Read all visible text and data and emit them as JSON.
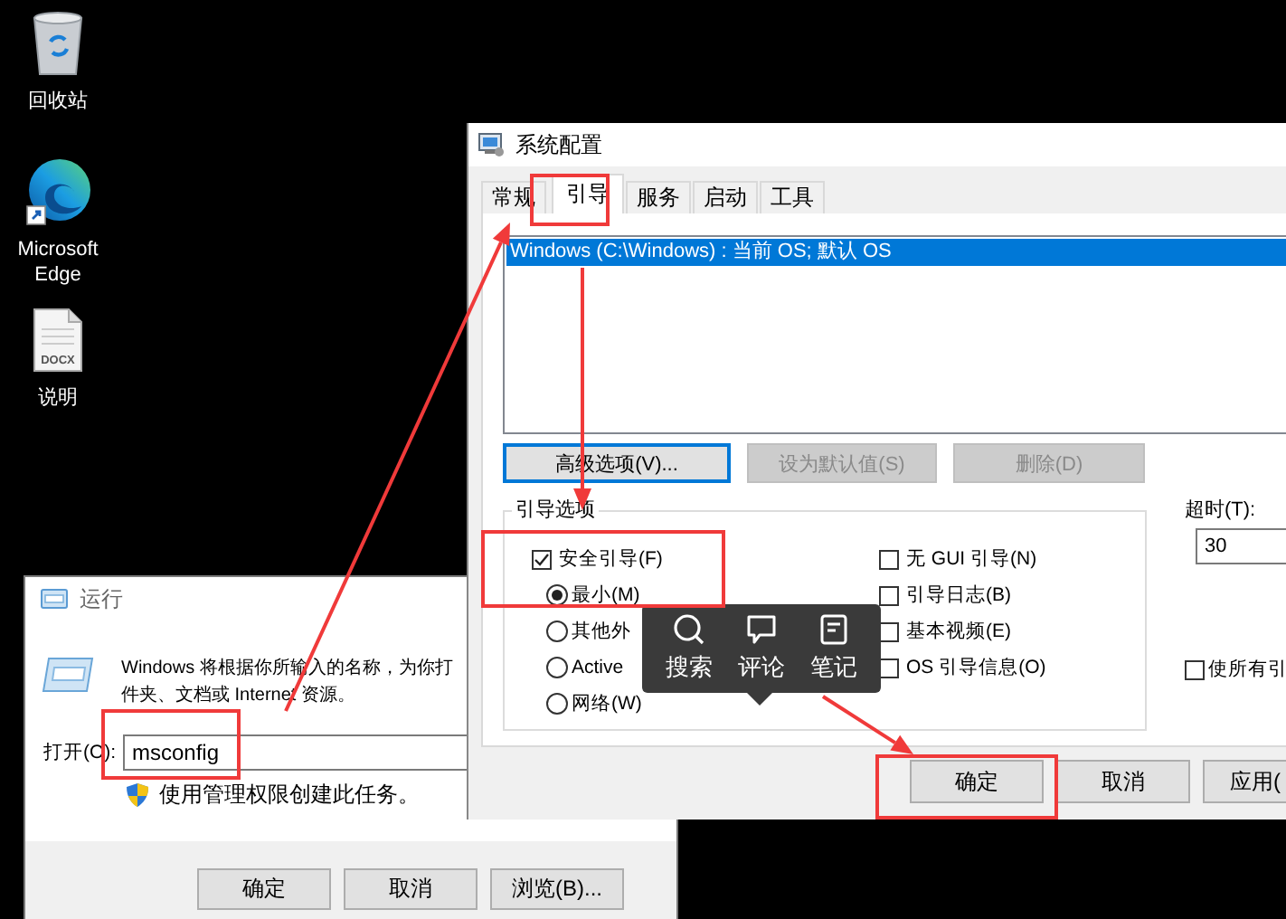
{
  "desktop": {
    "icons": [
      {
        "kind": "recycle-bin",
        "label": "回收站"
      },
      {
        "kind": "edge",
        "label": "Microsoft Edge"
      },
      {
        "kind": "document",
        "label": "说明",
        "file_type": "DOCX"
      }
    ]
  },
  "run_dialog": {
    "title": "运行",
    "description_lines": [
      "Windows 将根据你所输入的名称，为你打",
      "件夹、文档或 Internet 资源。"
    ],
    "open_label": "打开(O):",
    "open_value": "msconfig",
    "admin_note": "使用管理权限创建此任务。",
    "buttons": [
      "确定",
      "取消",
      "浏览(B)..."
    ]
  },
  "system_config": {
    "title": "系统配置",
    "tabs": [
      {
        "label": "常规",
        "selected": false
      },
      {
        "label": "引导",
        "selected": true
      },
      {
        "label": "服务",
        "selected": false
      },
      {
        "label": "启动",
        "selected": false
      },
      {
        "label": "工具",
        "selected": false
      }
    ],
    "boot_entries": [
      {
        "text": "Windows (C:\\Windows) : 当前 OS; 默认 OS",
        "selected": true
      }
    ],
    "entry_buttons": [
      {
        "label": "高级选项(V)...",
        "disabled": false,
        "focused": true
      },
      {
        "label": "设为默认值(S)",
        "disabled": true,
        "focused": false
      },
      {
        "label": "删除(D)",
        "disabled": true,
        "focused": false
      }
    ],
    "boot_options": {
      "title": "引导选项",
      "left": [
        {
          "kind": "checkbox",
          "label": "安全引导(F)",
          "checked": true
        },
        {
          "kind": "radio",
          "label": "最小(M)",
          "selected": true
        },
        {
          "kind": "radio",
          "label": "其他外",
          "selected": false
        },
        {
          "kind": "radio",
          "label": "Active",
          "selected": false
        },
        {
          "kind": "radio",
          "label": "网络(W)",
          "selected": false
        }
      ],
      "right": [
        {
          "kind": "checkbox",
          "label": "无 GUI 引导(N)",
          "checked": false
        },
        {
          "kind": "checkbox",
          "label": "引导日志(B)",
          "checked": false
        },
        {
          "kind": "checkbox",
          "label": "基本视频(E)",
          "checked": false
        },
        {
          "kind": "checkbox",
          "label": "OS 引导信息(O)",
          "checked": false
        }
      ]
    },
    "timeout": {
      "label": "超时(T):",
      "value": "30"
    },
    "permanent": {
      "label": "使所有引",
      "checked": false
    },
    "buttons": [
      "确定",
      "取消",
      "应用("
    ]
  },
  "popup_toolbar": {
    "items": [
      {
        "kind": "search",
        "label": "搜索"
      },
      {
        "kind": "comment",
        "label": "评论"
      },
      {
        "kind": "note",
        "label": "笔记"
      }
    ]
  }
}
